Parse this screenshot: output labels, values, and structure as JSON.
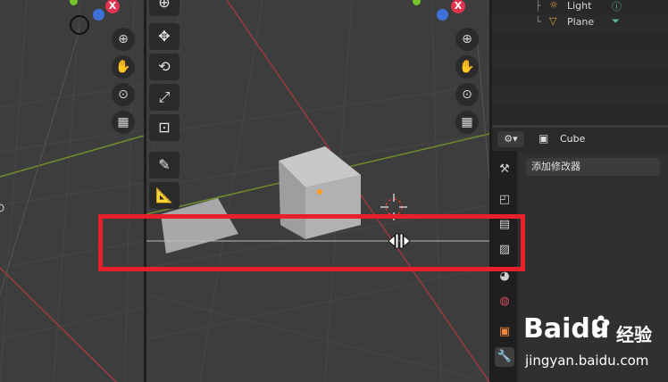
{
  "outliner": {
    "rows": [
      {
        "label": "Light",
        "icon": "light-bulb-icon"
      },
      {
        "label": "Plane",
        "icon": "mesh-triangle-icon"
      }
    ]
  },
  "properties": {
    "object_name": "Cube",
    "add_modifier_label": "添加修改器"
  },
  "gizmo": {
    "x_label": "X"
  },
  "watermark": {
    "brand": "Baidu",
    "brand_cn": "经验",
    "url": "jingyan.baidu.com"
  },
  "colors": {
    "highlight": "#e8202a",
    "grid_red_axis": "#9c3b3f",
    "grid_green_axis": "#6f8d2a",
    "viewport_bg": "#3d3d3d",
    "panel_bg": "#2b2b2b"
  },
  "tabs": [
    "tool-settings-icon",
    "render-icon",
    "output-icon",
    "view-layer-icon",
    "scene-icon",
    "world-icon",
    "object-icon",
    "modifier-wrench-icon"
  ]
}
